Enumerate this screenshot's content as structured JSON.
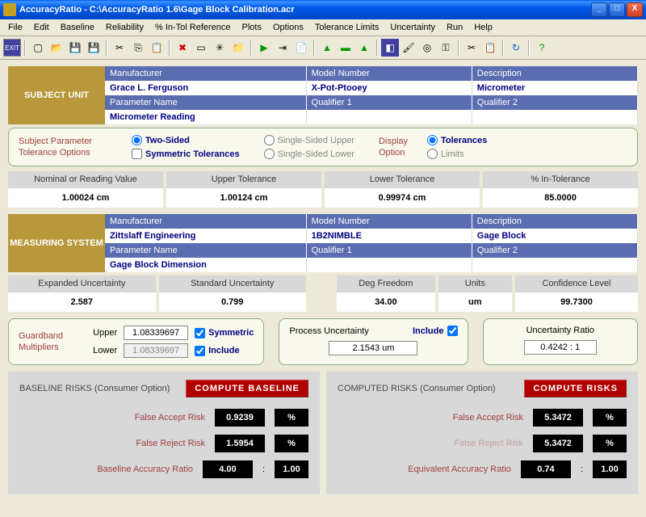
{
  "window": {
    "title": "AccuracyRatio - C:\\AccuracyRatio 1.6\\Gage Block Calibration.acr",
    "min": "_",
    "max": "□",
    "close": "X"
  },
  "menu": [
    "File",
    "Edit",
    "Baseline",
    "Reliability",
    "% In-Tol Reference",
    "Plots",
    "Options",
    "Tolerance Limits",
    "Uncertainty",
    "Run",
    "Help"
  ],
  "subject": {
    "label": "SUBJECT UNIT",
    "headers": {
      "mfr": "Manufacturer",
      "model": "Model Number",
      "desc": "Description",
      "param": "Parameter Name",
      "q1": "Qualifier 1",
      "q2": "Qualifier 2"
    },
    "values": {
      "mfr": "Grace L. Ferguson",
      "model": "X-Pot-Ptooey",
      "desc": "Micrometer",
      "param": "Micrometer Reading",
      "q1": "",
      "q2": ""
    }
  },
  "tolopts": {
    "label": "Subject Parameter Tolerance Options",
    "two_sided": "Two-Sided",
    "sym": "Symmetric Tolerances",
    "ssu": "Single-Sided Upper",
    "ssl": "Single-Sided Lower",
    "disp_label": "Display Option",
    "tol": "Tolerances",
    "lim": "Limits"
  },
  "tolvals": {
    "headers": {
      "nom": "Nominal or Reading Value",
      "up": "Upper Tolerance",
      "low": "Lower Tolerance",
      "pct": "% In-Tolerance"
    },
    "values": {
      "nom": "1.00024 cm",
      "up": "1.00124 cm",
      "low": "0.99974 cm",
      "pct": "85.0000"
    }
  },
  "meas": {
    "label": "MEASURING SYSTEM",
    "values": {
      "mfr": "Zittslaff Engineering",
      "model": "1B2NIMBLE",
      "desc": "Gage Block",
      "param": "Gage Block Dimension",
      "q1": "",
      "q2": ""
    }
  },
  "measvals": {
    "headers": {
      "eu": "Expanded Uncertainty",
      "su": "Standard Uncertainty",
      "df": "Deg Freedom",
      "un": "Units",
      "cl": "Confidence Level"
    },
    "values": {
      "eu": "2.587",
      "su": "0.799",
      "df": "34.00",
      "un": "um",
      "cl": "99.7300"
    }
  },
  "gb": {
    "label": "Guardband Multipliers",
    "upper_l": "Upper",
    "lower_l": "Lower",
    "upper": "1.08339697",
    "lower": "1.08339697",
    "sym": "Symmetric",
    "inc": "Include",
    "pu_label": "Process Uncertainty",
    "pu_inc": "Include",
    "pu_val": "2.1543 um",
    "ur_label": "Uncertainty Ratio",
    "ur_val": "0.4242 : 1"
  },
  "baseline": {
    "title": "BASELINE RISKS (Consumer Option)",
    "btn": "COMPUTE  BASELINE",
    "far_l": "False Accept Risk",
    "far": "0.9239",
    "pct": "%",
    "frr_l": "False Reject Risk",
    "frr": "1.5954",
    "bar_l": "Baseline Accuracy Ratio",
    "bar": "4.00",
    "sep": ":",
    "one": "1.00"
  },
  "computed": {
    "title": "COMPUTED RISKS (Consumer Option)",
    "btn": "COMPUTE  RISKS",
    "far_l": "False Accept Risk",
    "far": "5.3472",
    "pct": "%",
    "frr_l": "False Reject Risk",
    "frr": "5.3472",
    "ear_l": "Equivalent Accuracy Ratio",
    "ear": "0.74",
    "sep": ":",
    "one": "1.00"
  }
}
